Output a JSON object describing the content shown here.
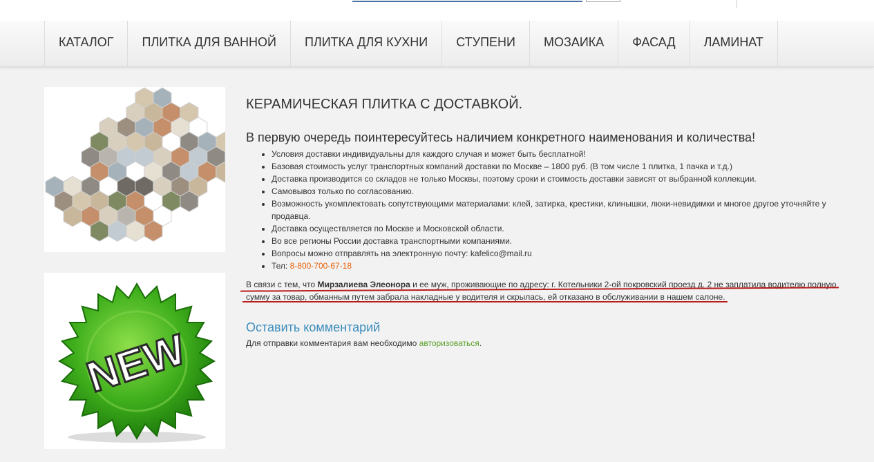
{
  "nav": {
    "items": [
      "КАТАЛОГ",
      "ПЛИТКА ДЛЯ ВАННОЙ",
      "ПЛИТКА ДЛЯ КУХНИ",
      "СТУПЕНИ",
      "МОЗАИКА",
      "ФАСАД",
      "ЛАМИНАТ"
    ]
  },
  "images": {
    "hex_tiles": "hexagon-tiles-image",
    "new_badge_text": "NEW"
  },
  "main": {
    "title": "КЕРАМИЧЕСКАЯ ПЛИТКА С ДОСТАВКОЙ.",
    "subtitle": "В первую очередь поинтересуйтесь наличием конкретного наименования и количества!",
    "list": [
      "Условия доставки индивидуальны для каждого случая и может быть бесплатной!",
      "Базовая стоимость услуг транспортных компаний доставки по Москве – 1800 руб. (В том числе 1 плитка, 1 пачка и т.д.)",
      "Доставка производится со складов не только Москвы, поэтому сроки и стоимость доставки зависят от выбранной коллекции.",
      "Самовывоз только по согласованию.",
      "Возможность укомплектовать сопутствующими материалами: клей, затирка, крестики, клинышки, люки-невидимки и многое другое уточняйте у продавца.",
      "Доставка осуществляется по Москве и Московской области.",
      "Во все регионы России доставка транспортными компаниями.",
      "Вопросы можно отправлять на электронную почту: kafelico@mail.ru"
    ],
    "phone_label": "Тел: ",
    "phone": "8-800-700-67-18",
    "notice_before": "В связи с тем, что ",
    "notice_name": "Мирзалиева Элеонора",
    "notice_after": " и ее муж, проживающие по адресу: г. Котельники 2-ой покровский проезд д. 2  не заплатила водителю полную сумму за товар, обманным путем забрала накладные у водителя и скрылась, ей отказано в обслуживании в нашем салоне.",
    "comment_heading": "Оставить комментарий",
    "comment_text": "Для отправки комментария вам необходимо ",
    "comment_link": "авторизоваться",
    "comment_end": "."
  },
  "colors": {
    "link_orange": "#e8620a",
    "link_green": "#5aa02c",
    "heading_blue": "#3b8dbd",
    "underline_red": "#b91c1c"
  }
}
